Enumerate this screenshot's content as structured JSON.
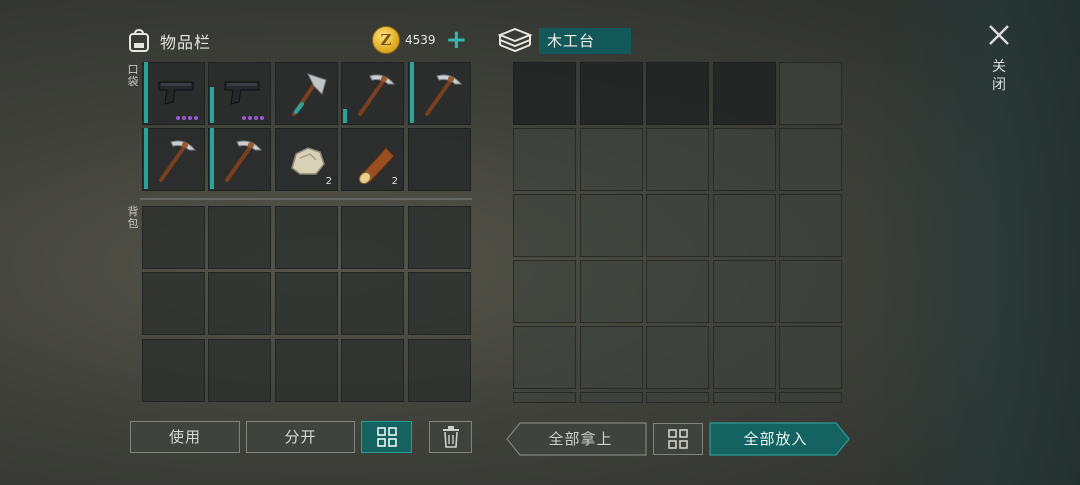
{
  "inventory": {
    "title": "物品栏",
    "pocket_label": "口袋",
    "backpack_label": "背包",
    "pocket_items": [
      {
        "icon": "pistol-icon",
        "durability_dots": 4
      },
      {
        "icon": "pistol-icon",
        "durability_dots": 4
      },
      {
        "icon": "hatchet-icon"
      },
      {
        "icon": "pickaxe-icon"
      },
      {
        "icon": "pickaxe-icon"
      },
      {
        "icon": "pickaxe-icon"
      },
      {
        "icon": "pickaxe-icon"
      },
      {
        "icon": "stone-icon",
        "count": "2"
      },
      {
        "icon": "log-icon",
        "count": "2"
      },
      {
        "icon": ""
      }
    ]
  },
  "currency": {
    "amount": "4539",
    "coin_symbol": "Z",
    "add_symbol": "+"
  },
  "workbench": {
    "title": "木工台"
  },
  "close": {
    "label": "关闭"
  },
  "buttons": {
    "use": "使用",
    "split": "分开",
    "take_all": "全部拿上",
    "put_all": "全部放入"
  },
  "colors": {
    "accent": "#2aa39b",
    "accent_dark": "#13595a",
    "coin": "#e1ad26",
    "rarity": "#9c5bd6"
  }
}
